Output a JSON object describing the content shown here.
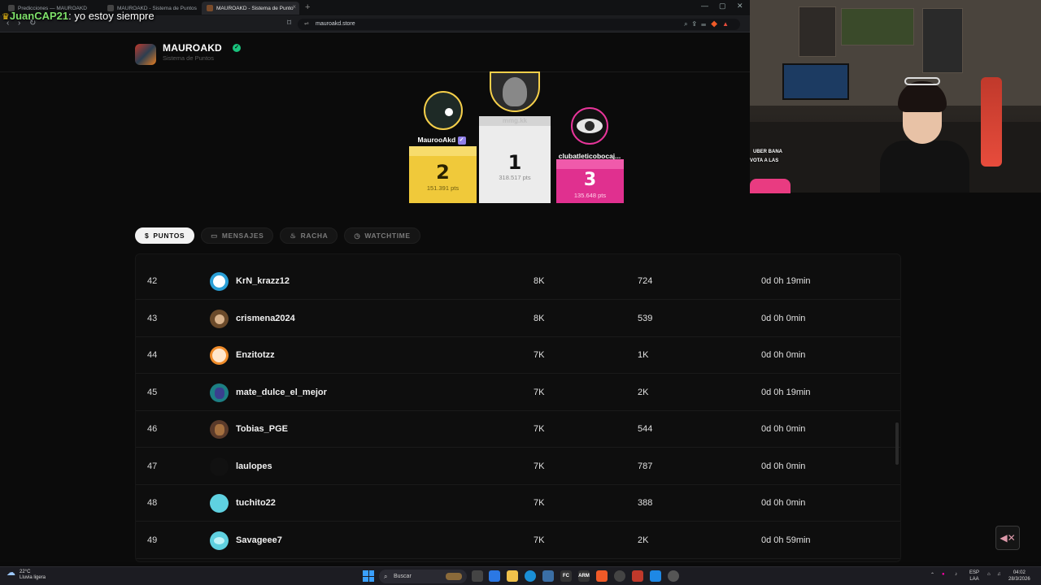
{
  "browser": {
    "tabs": [
      {
        "title": "Predicciones — MAUROAKD",
        "active": false
      },
      {
        "title": "MAUROAKD - Sistema de Puntos",
        "active": false
      },
      {
        "title": "MAUROAKD - Sistema de Punto",
        "active": true
      }
    ],
    "url": "mauroakd.store"
  },
  "chat_overlay": {
    "user": "JuanCAP21",
    "message": ": yo estoy siempre"
  },
  "header": {
    "brand": "MAUROAKD",
    "subtitle": "Sistema de Puntos"
  },
  "podium": [
    {
      "place": "2",
      "name": "MaurooAkd",
      "points": "151.391 pts",
      "color": "#f5cf4a"
    },
    {
      "place": "1",
      "name": "mmg.kk",
      "points": "318.517 pts",
      "color": "#f2f2f2"
    },
    {
      "place": "3",
      "name": "clubatleticobocaj...",
      "points": "135.648 pts",
      "color": "#e8359a"
    }
  ],
  "tabs": [
    {
      "label": "PUNTOS",
      "icon": "$",
      "active": true
    },
    {
      "label": "MENSAJES",
      "icon": "▭",
      "active": false
    },
    {
      "label": "RACHA",
      "icon": "♨",
      "active": false
    },
    {
      "label": "WATCHTIME",
      "icon": "◷",
      "active": false
    }
  ],
  "table": {
    "rows": [
      {
        "rank": "42",
        "name": "KrN_krazz12",
        "points": "8K",
        "messages": "724",
        "watchtime": "0d 0h 19min",
        "avatar_color": "#2a9fd6"
      },
      {
        "rank": "43",
        "name": "crismena2024",
        "points": "8K",
        "messages": "539",
        "watchtime": "0d 0h 0min",
        "avatar_color": "#6b4a2a"
      },
      {
        "rank": "44",
        "name": "Enzitotzz",
        "points": "7K",
        "messages": "1K",
        "watchtime": "0d 0h 0min",
        "avatar_color": "#f08c2a"
      },
      {
        "rank": "45",
        "name": "mate_dulce_el_mejor",
        "points": "7K",
        "messages": "2K",
        "watchtime": "0d 0h 19min",
        "avatar_color": "#1d7f84"
      },
      {
        "rank": "46",
        "name": "Tobias_PGE",
        "points": "7K",
        "messages": "544",
        "watchtime": "0d 0h 0min",
        "avatar_color": "#5a3a2a"
      },
      {
        "rank": "47",
        "name": "laulopes",
        "points": "7K",
        "messages": "787",
        "watchtime": "0d 0h 0min",
        "avatar_color": "#111111"
      },
      {
        "rank": "48",
        "name": "tuchito22",
        "points": "7K",
        "messages": "388",
        "watchtime": "0d 0h 0min",
        "avatar_color": "#5fd1e0"
      },
      {
        "rank": "49",
        "name": "Savageee7",
        "points": "7K",
        "messages": "2K",
        "watchtime": "0d 0h 59min",
        "avatar_color": "#5fd1e0"
      }
    ]
  },
  "webcam_overlay": {
    "line1": "UBER BANA",
    "line2": "VOTA A LAS"
  },
  "taskbar": {
    "weather_temp": "22°C",
    "weather_desc": "Lluvia ligera",
    "search_placeholder": "Buscar",
    "lang": "ESP",
    "lang2": "LAA",
    "time": "04:02",
    "date": "28/3/2026"
  }
}
